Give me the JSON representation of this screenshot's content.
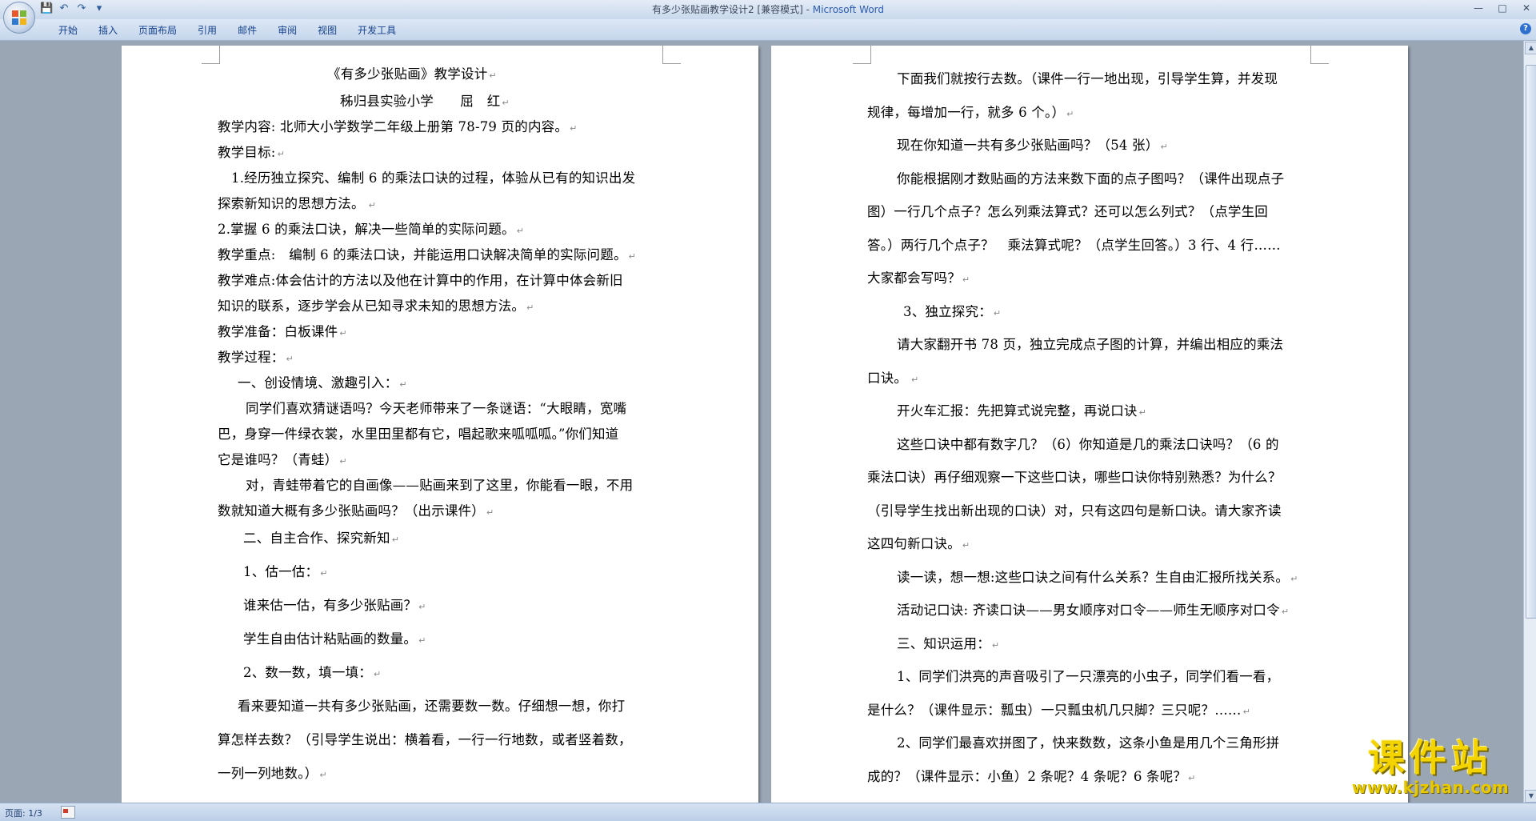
{
  "window": {
    "title": "有多少张贴画教学设计2 [兼容模式]",
    "title_sep": " - ",
    "app_name": "Microsoft Word",
    "minimize": "—",
    "maximize": "□",
    "close": "✕"
  },
  "quick_access": {
    "save": "💾",
    "undo": "↶",
    "redo": "↷",
    "more": "▾"
  },
  "ribbon": {
    "tabs": [
      "开始",
      "插入",
      "页面布局",
      "引用",
      "邮件",
      "审阅",
      "视图",
      "开发工具"
    ],
    "help": "?"
  },
  "left_page": {
    "lines": [
      "《有多少张贴画》教学设计",
      "秭归县实验小学　　屈　红",
      "教学内容: 北师大小学数学二年级上册第 78-79 页的内容。",
      "教学目标:",
      "1.经历独立探究、编制 6 的乘法口诀的过程，体验从已有的知识出发",
      "探索新知识的思想方法。",
      "2.掌握 6 的乘法口诀，解决一些简单的实际问题。",
      "教学重点:　编制 6 的乘法口诀，并能运用口诀解决简单的实际问题。",
      "教学难点:体会估计的方法以及他在计算中的作用，在计算中体会新旧",
      "知识的联系，逐步学会从已知寻求未知的思想方法。",
      "教学准备：白板课件",
      "教学过程：",
      "一、创设情境、激趣引入：",
      "同学们喜欢猜谜语吗？今天老师带来了一条谜语：“大眼睛，宽嘴",
      "巴，身穿一件绿衣裳，水里田里都有它，唱起歌来呱呱呱。”你们知道",
      "它是谁吗？（青蛙）",
      "对，青蛙带着它的自画像——贴画来到了这里，你能看一眼，不用",
      "数就知道大概有多少张贴画吗？（出示课件）",
      "二、自主合作、探究新知",
      "1、估一估：",
      "谁来估一估，有多少张贴画？",
      "学生自由估计粘贴画的数量。",
      "2、数一数，填一填：",
      "看来要知道一共有多少张贴画，还需要数一数。仔细想一想，你打",
      "算怎样去数？（引导学生说出：横着看，一行一行地数，或者竖着数，",
      "一列一列地数。）"
    ]
  },
  "right_page": {
    "lines": [
      "下面我们就按行去数。（课件一行一地出现，引导学生算，并发现",
      "规律，每增加一行，就多 6 个。）",
      "现在你知道一共有多少张贴画吗？（54 张）",
      "你能根据刚才数贴画的方法来数下面的点子图吗？（课件出现点子",
      "图）一行几个点子？怎么列乘法算式？还可以怎么列式？（点学生回",
      "答。）两行几个点子？　乘法算式呢？（点学生回答。）3 行、4 行……",
      "大家都会写吗？",
      "3、独立探究：",
      "请大家翻开书 78 页，独立完成点子图的计算，并编出相应的乘法",
      "口诀。",
      "开火车汇报：先把算式说完整，再说口诀",
      "这些口诀中都有数字几？（6）你知道是几的乘法口诀吗？（6 的",
      "乘法口诀）再仔细观察一下这些口诀，哪些口诀你特别熟悉？为什么？",
      "（引导学生找出新出现的口诀）对，只有这四句是新口诀。请大家齐读",
      "这四句新口诀。",
      "读一读，想一想:这些口诀之间有什么关系？生自由汇报所找关系。",
      "活动记口诀: 齐读口诀——男女顺序对口令——师生无顺序对口令",
      "三、知识运用：",
      "1、同学们洪亮的声音吸引了一只漂亮的小虫子，同学们看一看，",
      "是什么？（课件显示：瓢虫）一只瓢虫机几只脚？三只呢？……",
      "2、同学们最喜欢拼图了，快来数数，这条小鱼是用几个三角形拼",
      "成的？（课件显示：小鱼）2 条呢？4 条呢？6 条呢？"
    ]
  },
  "status": {
    "page": "页面: 1/3"
  },
  "watermark": {
    "text": "课件站",
    "url": "www.kjzhan.com"
  }
}
